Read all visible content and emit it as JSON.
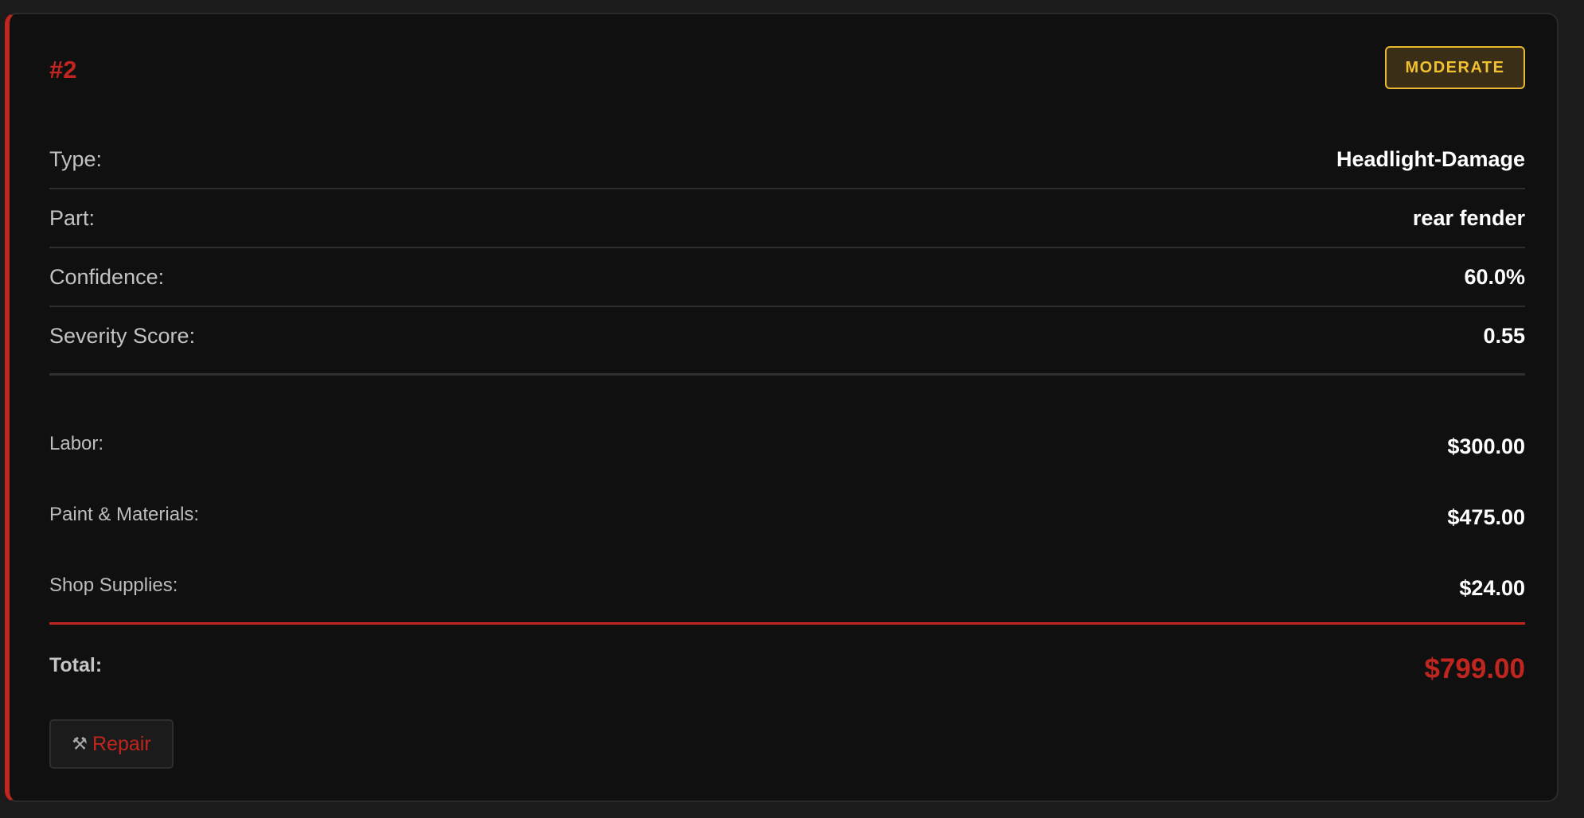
{
  "card": {
    "id_label": "#2",
    "severity": "MODERATE",
    "details": [
      {
        "label": "Type:",
        "value": "Headlight-Damage"
      },
      {
        "label": "Part:",
        "value": "rear fender"
      },
      {
        "label": "Confidence:",
        "value": "60.0%"
      },
      {
        "label": "Severity Score:",
        "value": "0.55"
      }
    ],
    "costs": [
      {
        "label": "Labor:",
        "value": "$300.00"
      },
      {
        "label": "Paint & Materials:",
        "value": "$475.00"
      },
      {
        "label": "Shop Supplies:",
        "value": "$24.00"
      }
    ],
    "total": {
      "label": "Total:",
      "value": "$799.00"
    },
    "repair_button": {
      "icon": "hammer-wrench-icon",
      "label": "Repair"
    }
  },
  "colors": {
    "accent": "#c0261f",
    "badge_border": "#e8b830",
    "badge_bg": "#3b2e17",
    "badge_text": "#f0c030",
    "card_bg": "#101010",
    "page_bg": "#1b1b1b"
  }
}
